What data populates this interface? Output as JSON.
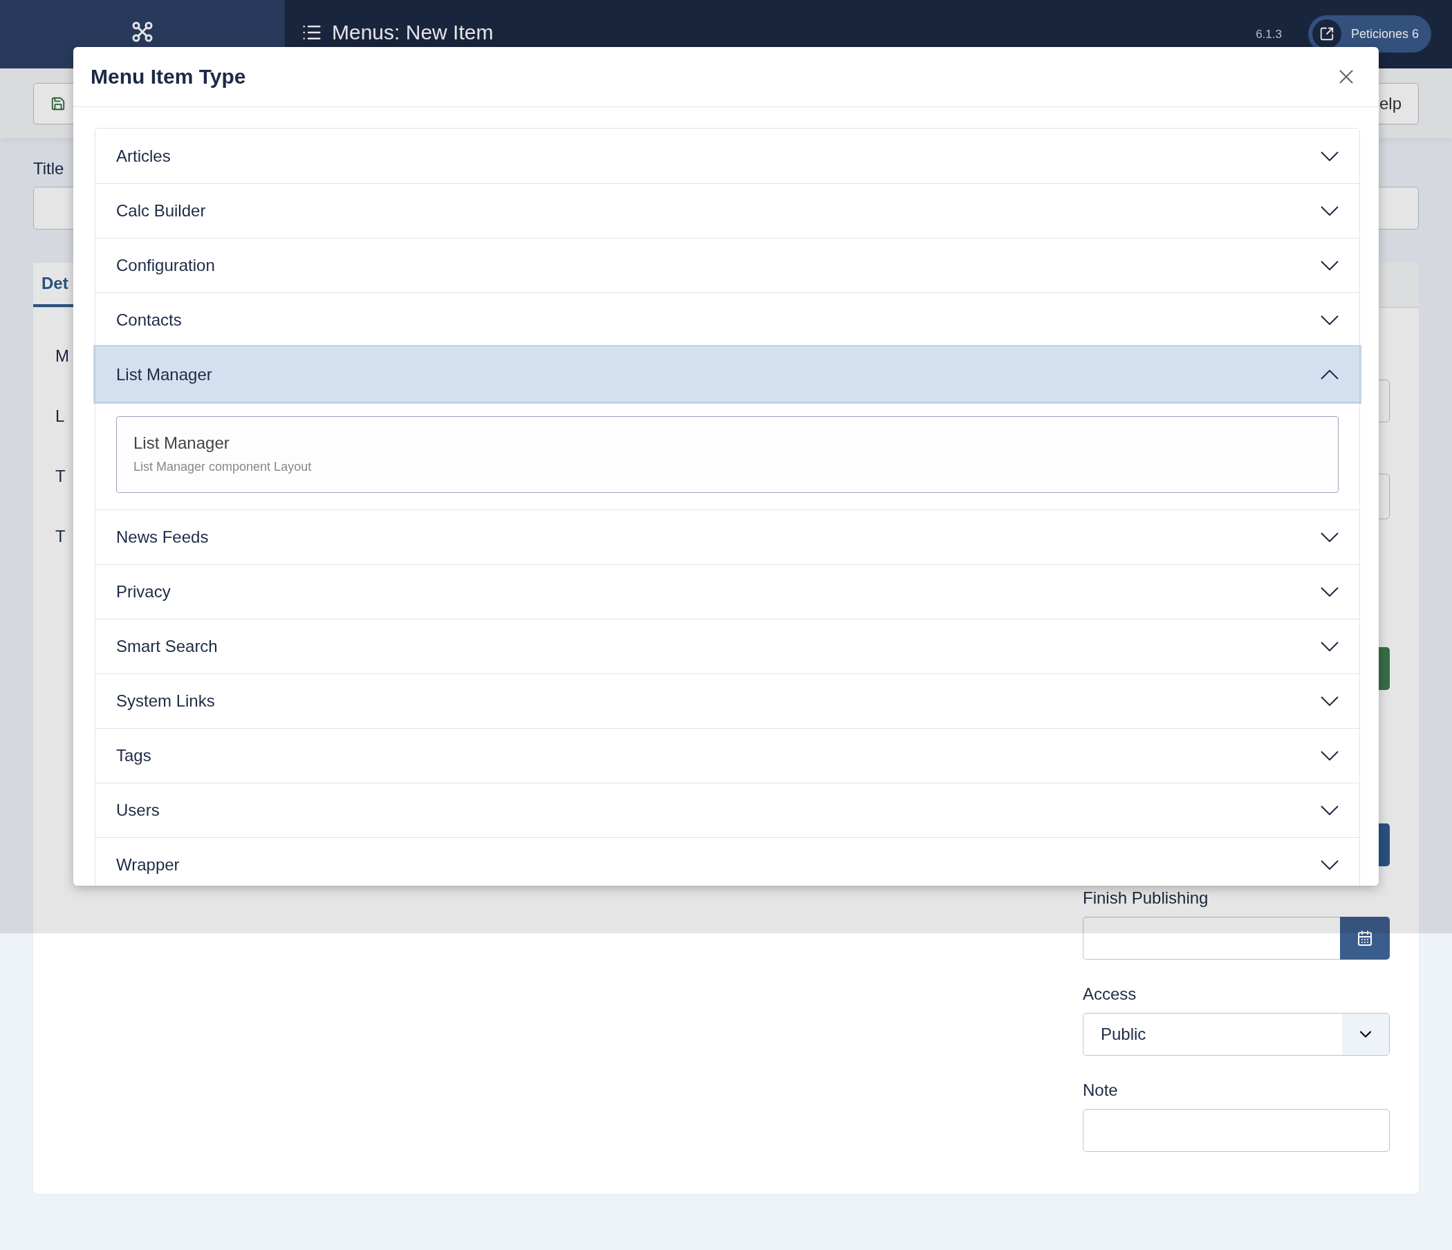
{
  "header": {
    "title": "Menus: New Item",
    "version": "6.1.3",
    "user_button": "Peticiones 6"
  },
  "toolbar": {
    "help_button": "elp"
  },
  "form": {
    "title_label": "Title",
    "tab": {
      "label": "Det",
      "selected": true
    },
    "left_labels": [
      "M",
      "L",
      "T",
      "T"
    ],
    "finish_publishing": {
      "label": "Finish Publishing"
    },
    "access": {
      "label": "Access",
      "value": "Public"
    },
    "note": {
      "label": "Note"
    }
  },
  "modal": {
    "title": "Menu Item Type",
    "groups": [
      {
        "label": "Articles",
        "expanded": false
      },
      {
        "label": "Calc Builder",
        "expanded": false
      },
      {
        "label": "Configuration",
        "expanded": false
      },
      {
        "label": "Contacts",
        "expanded": false
      },
      {
        "label": "List Manager",
        "expanded": true,
        "options": [
          {
            "title": "List Manager",
            "description": "List Manager component Layout"
          }
        ]
      },
      {
        "label": "News Feeds",
        "expanded": false
      },
      {
        "label": "Privacy",
        "expanded": false
      },
      {
        "label": "Smart Search",
        "expanded": false
      },
      {
        "label": "System Links",
        "expanded": false
      },
      {
        "label": "Tags",
        "expanded": false
      },
      {
        "label": "Users",
        "expanded": false
      },
      {
        "label": "Wrapper",
        "expanded": false
      }
    ]
  }
}
